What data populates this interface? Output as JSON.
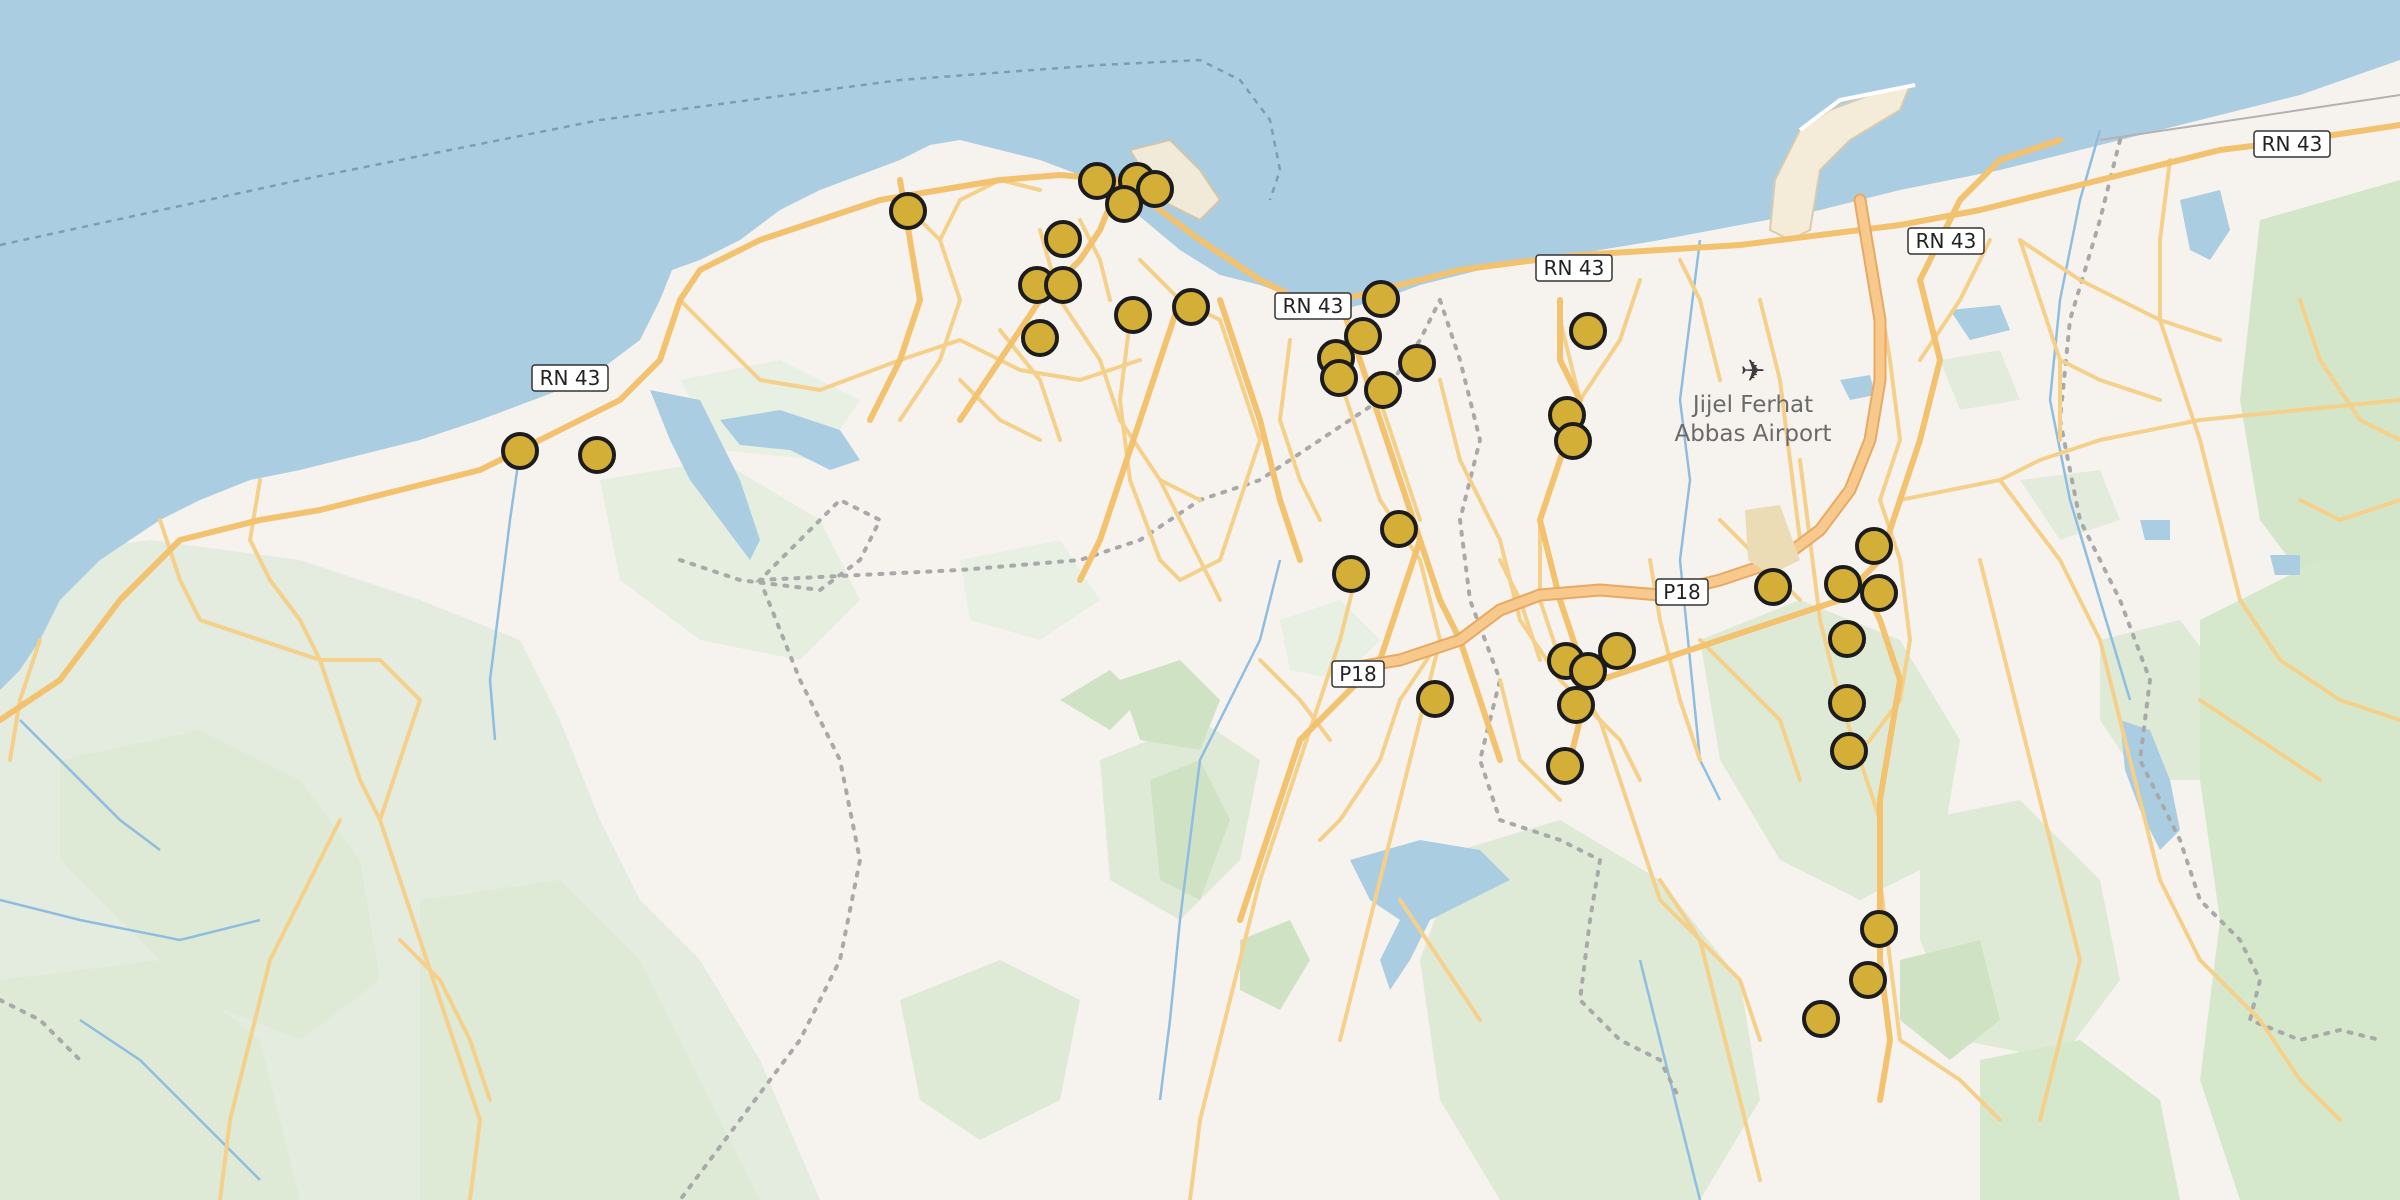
{
  "map": {
    "colors": {
      "water": "#abcde2",
      "land": "#f6f3ee",
      "forest": "#d8e9cf",
      "forest_light": "#e5ede0",
      "road": "#f6cf78",
      "road_casing": "#e9b75a",
      "major_road": "#f4bc6b",
      "boundary": "#a9a9a9",
      "marker_fill": "#d4af37",
      "marker_stroke": "#1c1c1c"
    },
    "road_labels": [
      {
        "id": "rn43-1",
        "text": "RN 43"
      },
      {
        "id": "rn43-2",
        "text": "RN 43"
      },
      {
        "id": "rn43-3",
        "text": "RN 43"
      },
      {
        "id": "rn43-4",
        "text": "RN 43"
      },
      {
        "id": "rn43-5",
        "text": "RN 43"
      },
      {
        "id": "p18-1",
        "text": "P18"
      },
      {
        "id": "p18-2",
        "text": "P18"
      }
    ],
    "airport": {
      "icon": "airplane-icon",
      "name_line1": "Jijel Ferhat",
      "name_line2": "Abbas Airport"
    },
    "marker_count": 44
  }
}
